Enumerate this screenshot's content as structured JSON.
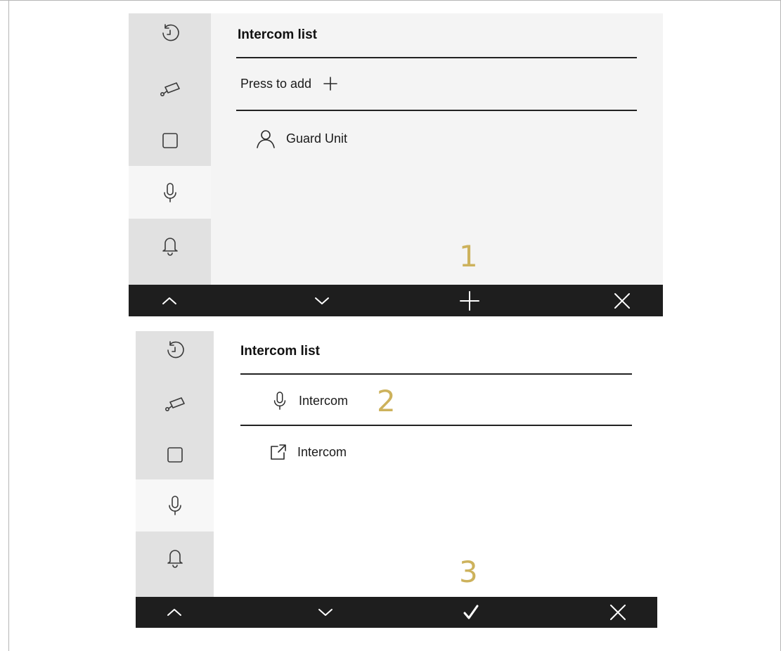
{
  "colors": {
    "accent_step": "#cdb25c",
    "sidebar_bg": "#e1e1e1",
    "bar_bg": "#1e1e1e"
  },
  "screen1": {
    "title": "Intercom list",
    "add_row_label": "Press to add",
    "items": [
      {
        "icon": "user-icon",
        "label": "Guard Unit"
      }
    ],
    "step_marker": "1",
    "bottombar": [
      "chevron-up-icon",
      "chevron-down-icon",
      "plus-icon",
      "close-icon"
    ]
  },
  "screen2": {
    "title": "Intercom list",
    "items": [
      {
        "icon": "microphone-icon",
        "label": "Intercom"
      },
      {
        "icon": "external-link-icon",
        "label": "Intercom"
      }
    ],
    "step_marker_2": "2",
    "step_marker_3": "3",
    "bottombar": [
      "chevron-up-icon",
      "chevron-down-icon",
      "checkmark-icon",
      "close-icon"
    ]
  },
  "sidebar_icons": [
    "history-icon",
    "camera-icon",
    "square-icon",
    "microphone-icon",
    "bell-icon"
  ],
  "sidebar_active": "microphone-icon"
}
